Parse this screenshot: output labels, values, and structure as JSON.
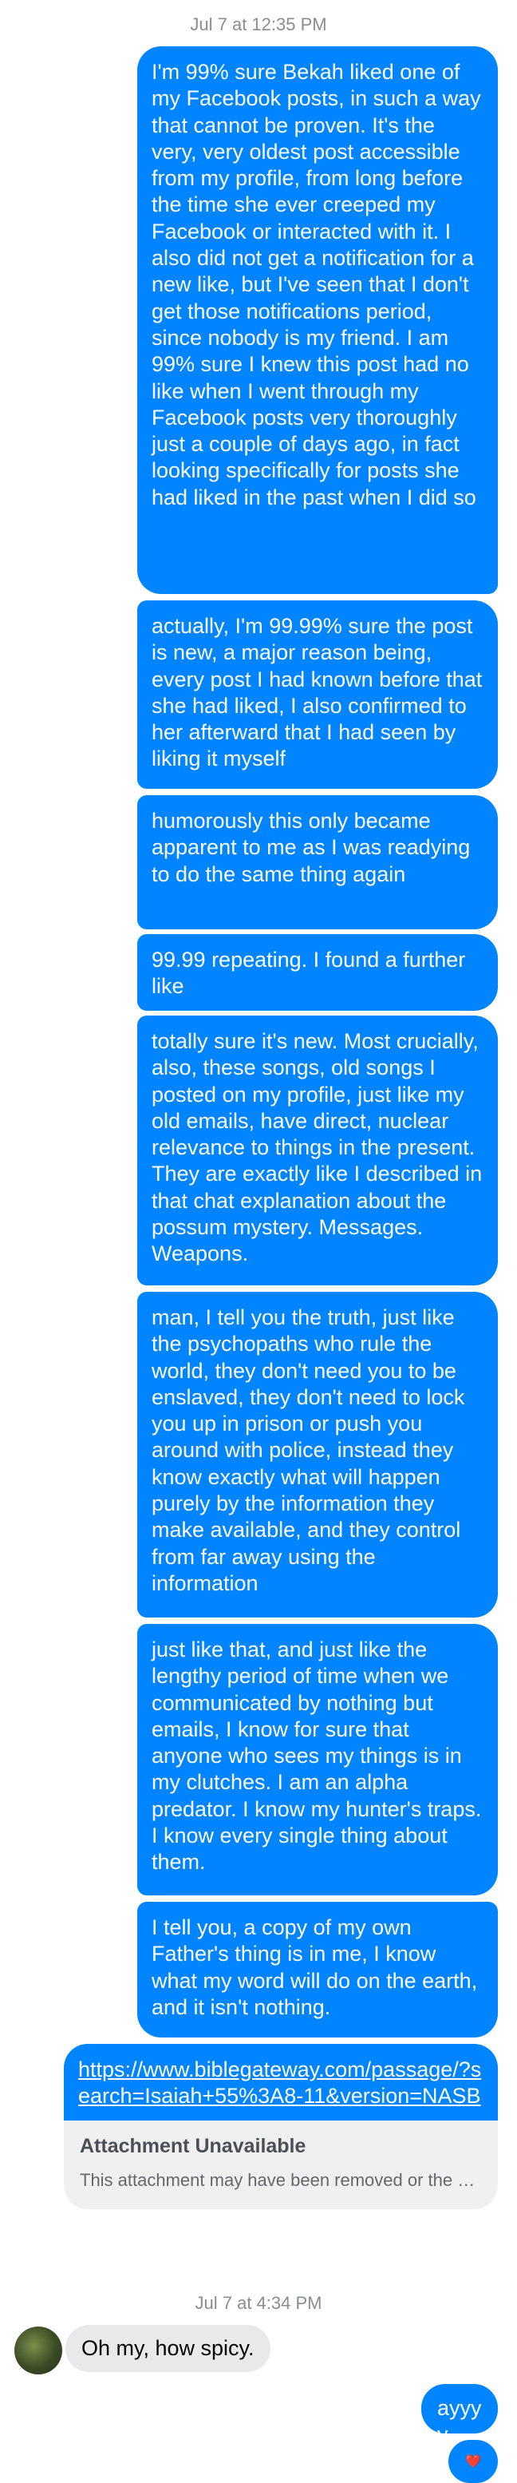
{
  "thread": {
    "timestamp_1": "Jul 7 at 12:35 PM",
    "messages": [
      "I'm 99% sure Bekah liked one of my Facebook posts, in such a way that cannot be proven. It's the very, very oldest post accessible from my profile, from long before the time she ever creeped my Facebook or interacted with it. I also did not get a notification for a new like, but I've seen that I don't get those notifications period, since nobody is my friend. I am 99% sure I knew this post had no like when I went through my Facebook posts very thoroughly just a couple of days ago, in fact looking specifically for posts she had liked in the past when I did so",
      "actually, I'm 99.99% sure the post is new, a major reason being, every post I had known before that she had liked, I also confirmed to her afterward that I had seen by liking it myself",
      "humorously this only became apparent to me as I was readying to do the same thing again",
      "99.99 repeating. I found a further like",
      "totally sure it's new. Most crucially, also, these songs, old songs I posted on my profile, just like my old emails, have direct, nuclear relevance to things in the present. They are exactly like I described in that chat explanation about the possum mystery. Messages. Weapons.",
      "man, I tell you the truth, just like the psychopaths who rule the world, they don't need you to be enslaved, they don't need to lock you up in prison or push you around with police, instead they know exactly what will happen purely by the information they make available, and they control from far away using the information",
      "just like that, and just like the lengthy period of time when we communicated by nothing but emails, I know for sure that anyone who sees my things is in my clutches. I am an alpha predator. I know my hunter's traps. I know every single thing about them.",
      "I tell you, a copy of my own Father's thing is in me, I know what my word will do on the earth, and it isn't nothing."
    ],
    "link": {
      "url": "https://www.biblegateway.com/passage/?search=Isaiah+55%3A8-11&version=NASB",
      "attachment_title": "Attachment Unavailable",
      "attachment_desc": "This attachment may have been removed or the person who shared it may not have permission to share it with you."
    },
    "timestamp_2": "Jul 7 at 4:34 PM",
    "incoming_message": "Oh my, how spicy.",
    "reply": "ayyyy",
    "reaction": "❤️"
  },
  "colors": {
    "outgoing_bubble": "#0084ff",
    "incoming_bubble": "#e9e9eb",
    "timestamp": "#8a8d91"
  }
}
